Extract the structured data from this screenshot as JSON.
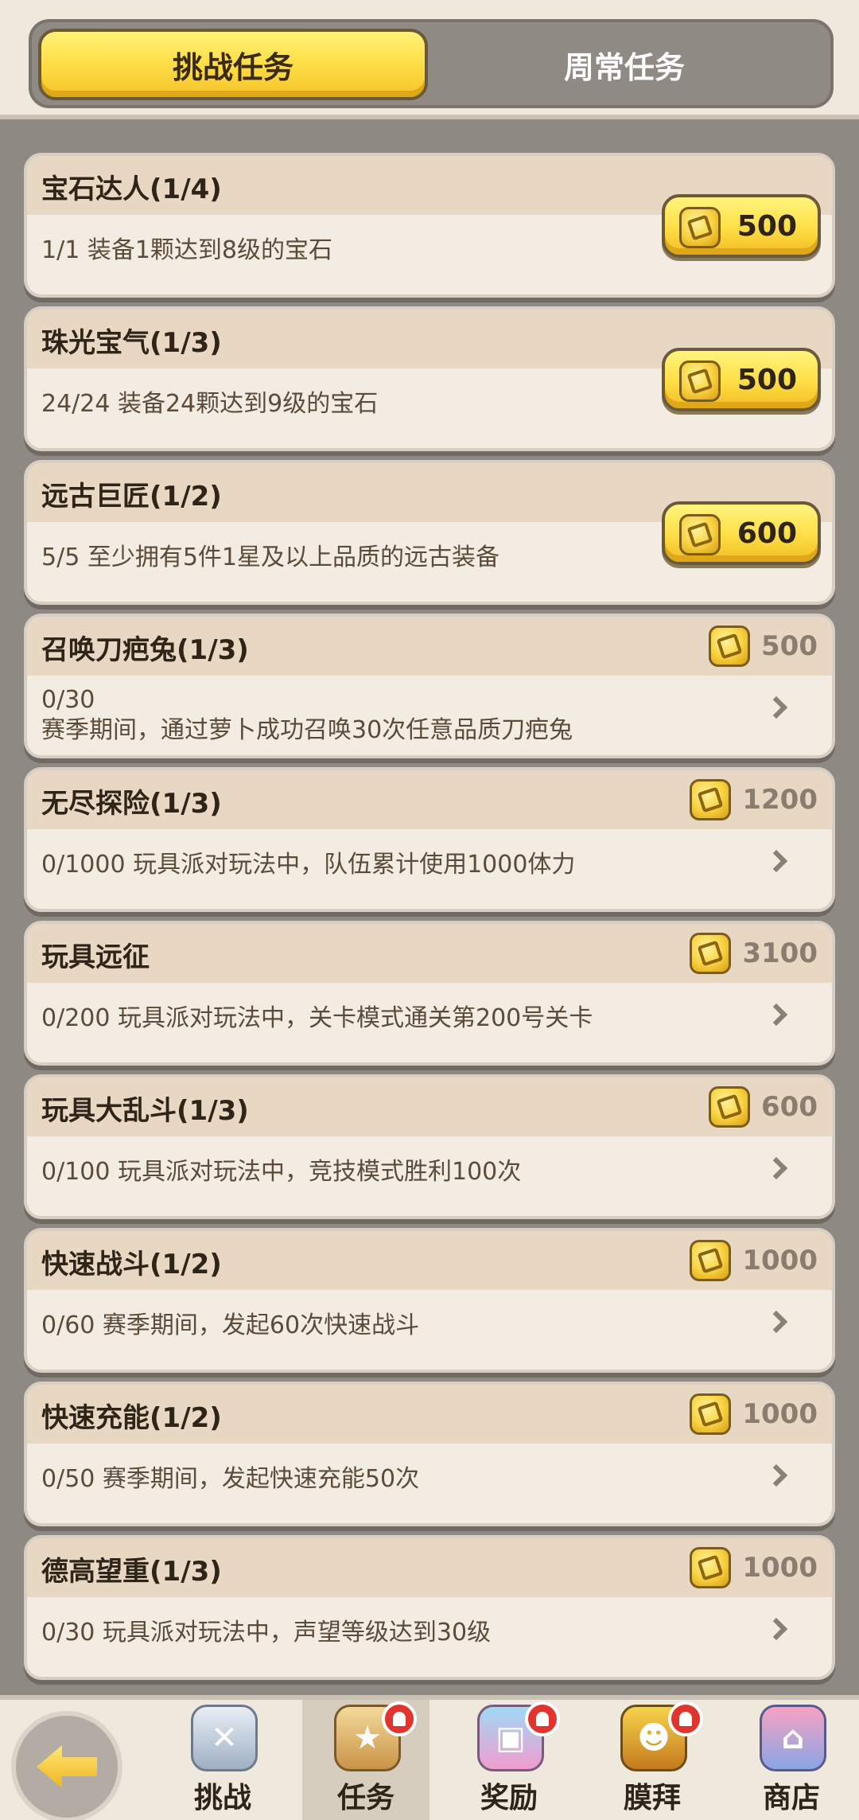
{
  "tabs": {
    "challenge": "挑战任务",
    "weekly": "周常任务"
  },
  "tasks": [
    {
      "title": "宝石达人(1/4)",
      "desc": "1/1 装备1颗达到8级的宝石",
      "reward": "500",
      "claimable": true
    },
    {
      "title": "珠光宝气(1/3)",
      "desc": "24/24 装备24颗达到9级的宝石",
      "reward": "500",
      "claimable": true
    },
    {
      "title": "远古巨匠(1/2)",
      "desc": "5/5 至少拥有5件1星及以上品质的远古装备",
      "reward": "600",
      "claimable": true
    },
    {
      "title": "召唤刀疤兔(1/3)",
      "progress": "0/30",
      "desc": "赛季期间，通过萝卜成功召唤30次任意品质刀疤兔",
      "reward": "500",
      "claimable": false
    },
    {
      "title": "无尽探险(1/3)",
      "desc": "0/1000 玩具派对玩法中，队伍累计使用1000体力",
      "reward": "1200",
      "claimable": false
    },
    {
      "title": "玩具远征",
      "desc": "0/200 玩具派对玩法中，关卡模式通关第200号关卡",
      "reward": "3100",
      "claimable": false
    },
    {
      "title": "玩具大乱斗(1/3)",
      "desc": "0/100 玩具派对玩法中，竞技模式胜利100次",
      "reward": "600",
      "claimable": false
    },
    {
      "title": "快速战斗(1/2)",
      "desc": "0/60 赛季期间，发起60次快速战斗",
      "reward": "1000",
      "claimable": false
    },
    {
      "title": "快速充能(1/2)",
      "desc": "0/50 赛季期间，发起快速充能50次",
      "reward": "1000",
      "claimable": false
    },
    {
      "title": "德高望重(1/3)",
      "desc": "0/30 玩具派对玩法中，声望等级达到30级",
      "reward": "1000",
      "claimable": false
    }
  ],
  "nav": {
    "challenge": "挑战",
    "tasks": "任务",
    "rewards": "奖励",
    "worship": "膜拜",
    "shop": "商店",
    "active": "tasks"
  },
  "icons": {
    "reward": "coin-icon",
    "back": "back-arrow-icon",
    "more": "chevron-right-icon"
  },
  "colors": {
    "accent": "#ffe04a",
    "background": "#8e8983",
    "card": "#f3ece2",
    "badge": "#e0342c"
  }
}
